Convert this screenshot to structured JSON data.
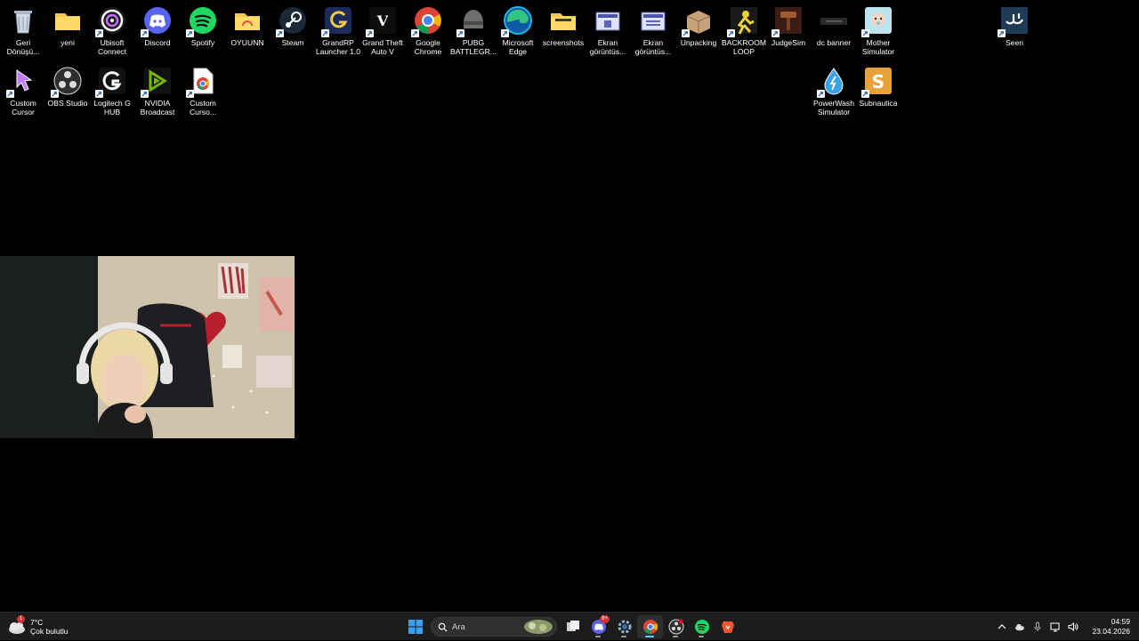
{
  "desktop": {
    "icons": [
      {
        "label": "Geri Dönüşü...",
        "icon": "recycle-bin-icon",
        "shortcut": false
      },
      {
        "label": "yeni",
        "icon": "folder-icon",
        "shortcut": false
      },
      {
        "label": "Ubisoft Connect",
        "icon": "ubisoft-icon",
        "shortcut": true
      },
      {
        "label": "Discord",
        "icon": "discord-icon",
        "shortcut": true
      },
      {
        "label": "Spotify",
        "icon": "spotify-icon",
        "shortcut": true
      },
      {
        "label": "OYUUNN",
        "icon": "folder-icon",
        "shortcut": false
      },
      {
        "label": "Steam",
        "icon": "steam-icon",
        "shortcut": true
      },
      {
        "label": "GrandRP Launcher 1.0",
        "icon": "grandrp-icon",
        "shortcut": true
      },
      {
        "label": "Grand Theft Auto V",
        "icon": "gta-icon",
        "shortcut": true
      },
      {
        "label": "Google Chrome",
        "icon": "chrome-icon",
        "shortcut": true
      },
      {
        "label": "PUBG BATTLEGR...",
        "icon": "pubg-icon",
        "shortcut": true
      },
      {
        "label": "Microsoft Edge",
        "icon": "edge-icon",
        "shortcut": true
      },
      {
        "label": "screenshots",
        "icon": "folder-icon",
        "shortcut": false
      },
      {
        "label": "Ekran görüntüs...",
        "icon": "image-file-icon",
        "shortcut": false
      },
      {
        "label": "Ekran görüntüs...",
        "icon": "image-file-icon",
        "shortcut": false
      },
      {
        "label": "Unpacking",
        "icon": "unpacking-icon",
        "shortcut": true
      },
      {
        "label": "BACKROOM LOOP",
        "icon": "backroom-icon",
        "shortcut": true
      },
      {
        "label": "JudgeSim",
        "icon": "judgesim-icon",
        "shortcut": true
      },
      {
        "label": "dc banner",
        "icon": "banner-image-icon",
        "shortcut": false
      },
      {
        "label": "Mother Simulator",
        "icon": "mother-sim-icon",
        "shortcut": true
      },
      {
        "label": "Seen",
        "icon": "seen-icon",
        "shortcut": true
      },
      {
        "label": "Custom Cursor",
        "icon": "cursor-icon",
        "shortcut": true
      },
      {
        "label": "OBS Studio",
        "icon": "obs-icon",
        "shortcut": true
      },
      {
        "label": "Logitech G HUB",
        "icon": "logitech-icon",
        "shortcut": true
      },
      {
        "label": "NVIDIA Broadcast",
        "icon": "nvidia-icon",
        "shortcut": true
      },
      {
        "label": "Custom Curso...",
        "icon": "chrome-file-icon",
        "shortcut": true
      },
      {
        "label": "PowerWash Simulator",
        "icon": "powerwash-icon",
        "shortcut": true
      },
      {
        "label": "Subnautica",
        "icon": "subnautica-icon",
        "shortcut": true
      }
    ]
  },
  "weather": {
    "temp": "7°C",
    "desc": "Çok bulutlu",
    "badge": "1"
  },
  "search": {
    "placeholder": "Ara"
  },
  "taskbar": {
    "apps": [
      "start",
      "search",
      "task-view",
      "discord",
      "settings",
      "chrome",
      "obs",
      "spotify",
      "brave"
    ],
    "discord_badge": "9+"
  },
  "clock": {
    "time": "04:59",
    "date": "23.04.2026"
  },
  "colors": {
    "taskbar": "#1c1c1c",
    "accent": "#60cdff",
    "desktop": "#000000"
  }
}
